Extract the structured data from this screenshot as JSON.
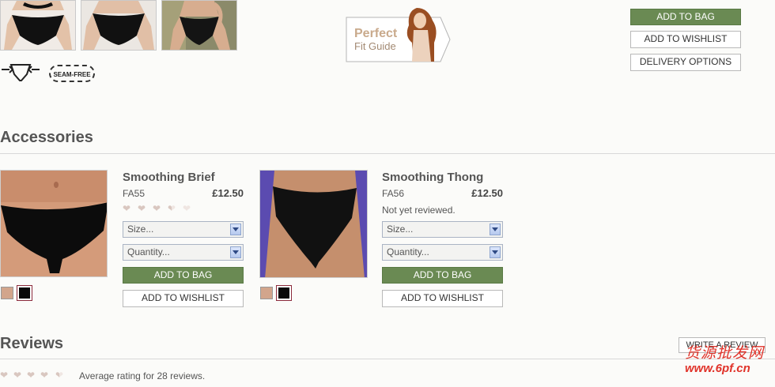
{
  "top": {
    "actions": {
      "add_to_bag": "ADD TO BAG",
      "add_to_wishlist": "ADD TO WISHLIST",
      "delivery_options": "DELIVERY OPTIONS"
    },
    "fit_guide": {
      "line1": "Perfect",
      "line2": "Fit Guide"
    },
    "badge_seam_free": "SEAM-FREE"
  },
  "accessories": {
    "heading": "Accessories",
    "products": [
      {
        "title": "Smoothing Brief",
        "code": "FA55",
        "price": "£12.50",
        "rating_hearts": 3.5,
        "size_placeholder": "Size...",
        "quantity_placeholder": "Quantity...",
        "add_to_bag": "ADD TO BAG",
        "add_to_wishlist": "ADD TO WISHLIST",
        "swatches": [
          "#d2a58c",
          "#0a0a0a"
        ]
      },
      {
        "title": "Smoothing Thong",
        "code": "FA56",
        "price": "£12.50",
        "review_status": "Not yet reviewed.",
        "size_placeholder": "Size...",
        "quantity_placeholder": "Quantity...",
        "add_to_bag": "ADD TO BAG",
        "add_to_wishlist": "ADD TO WISHLIST",
        "swatches": [
          "#d2a58c",
          "#0a0a0a"
        ]
      }
    ]
  },
  "reviews": {
    "heading": "Reviews",
    "write_review": "WRITE A REVIEW",
    "average_text": "Average rating for 28 reviews.",
    "rating_hearts": 4.5
  },
  "watermark": {
    "line1": "货源批发网",
    "line2": "www.6pf.cn"
  },
  "colors": {
    "accent_green": "#6a8a53",
    "heart": "#d9c7c0",
    "watermark_red": "#e0332a"
  }
}
